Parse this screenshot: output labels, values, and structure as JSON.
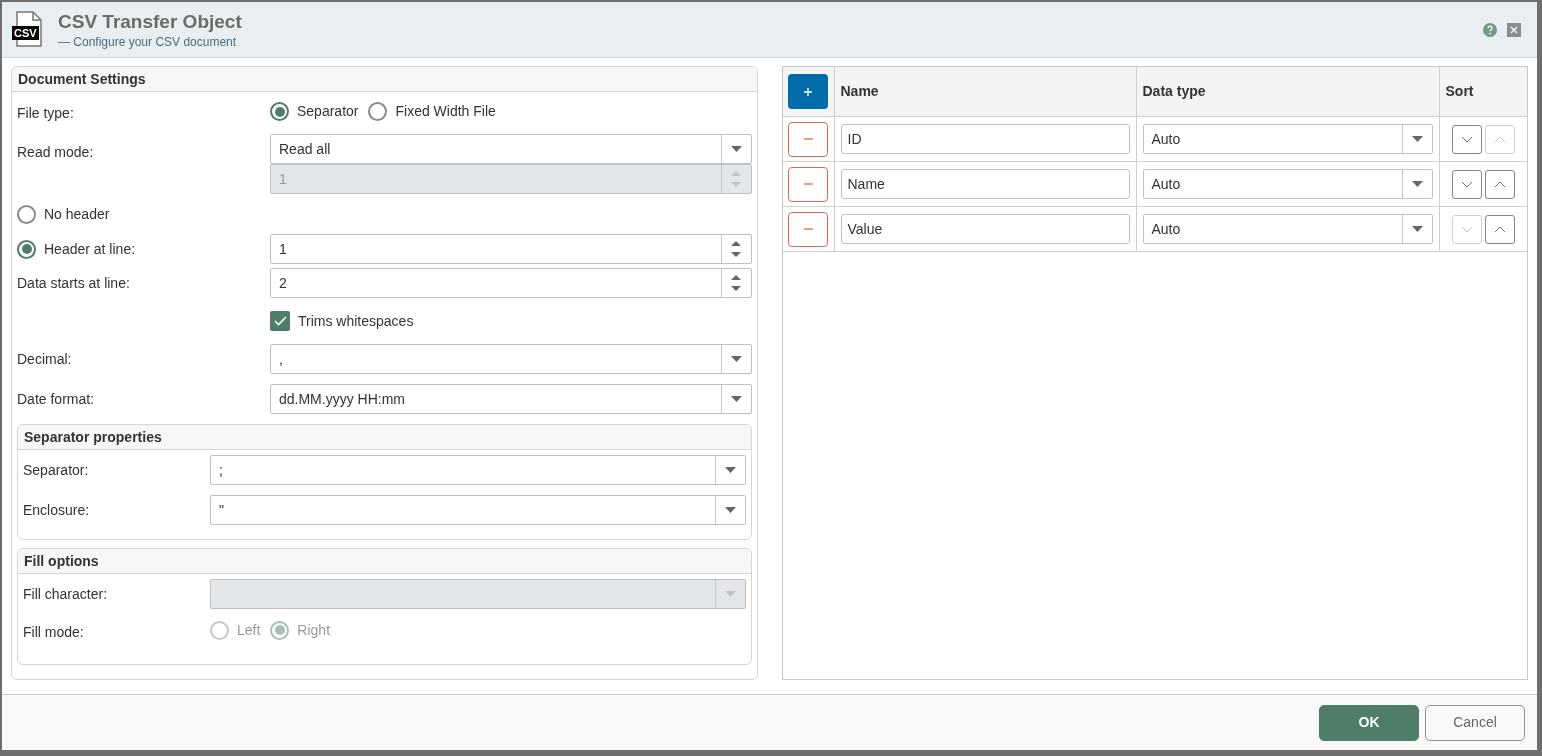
{
  "window": {
    "logo_text": "CSV",
    "title": "CSV Transfer Object",
    "subtitle": "— Configure your CSV document"
  },
  "document_settings": {
    "title": "Document Settings",
    "file_type": {
      "label": "File type:",
      "options": [
        {
          "label": "Separator",
          "selected": true
        },
        {
          "label": "Fixed Width File",
          "selected": false
        }
      ]
    },
    "read_mode": {
      "label": "Read mode:",
      "value": "Read all",
      "line_count": {
        "value": "1",
        "disabled": true
      }
    },
    "header_options": [
      {
        "label": "No header",
        "selected": false
      },
      {
        "label": "Header at line:",
        "selected": true,
        "value": "1"
      }
    ],
    "data_start": {
      "label": "Data starts at line:",
      "value": "2"
    },
    "trim": {
      "label": "Trims whitespaces",
      "checked": true
    },
    "decimal": {
      "label": "Decimal:",
      "value": ","
    },
    "date_format": {
      "label": "Date format:",
      "value": "dd.MM.yyyy HH:mm"
    }
  },
  "separator_properties": {
    "title": "Separator properties",
    "fields": [
      {
        "label": "Separator:",
        "value": ";"
      },
      {
        "label": "Enclosure:",
        "value": "\""
      }
    ]
  },
  "fill_options": {
    "title": "Fill options",
    "fill_character": {
      "label": "Fill character:",
      "disabled": true
    },
    "fill_mode": {
      "label": "Fill mode:",
      "disabled": true,
      "options": [
        {
          "label": "Left",
          "selected": false
        },
        {
          "label": "Right",
          "selected": true
        }
      ]
    }
  },
  "columns_table": {
    "columns": [
      "Name",
      "Data type",
      "Sort"
    ],
    "rows": [
      {
        "name": "ID",
        "data_type": "Auto",
        "down_disabled": false,
        "up_disabled": true
      },
      {
        "name": "Name",
        "data_type": "Auto",
        "down_disabled": false,
        "up_disabled": false
      },
      {
        "name": "Value",
        "data_type": "Auto",
        "down_disabled": true,
        "up_disabled": false
      }
    ]
  },
  "buttons": [
    {
      "label": "OK",
      "kind": "primary"
    },
    {
      "label": "Cancel",
      "kind": "secondary"
    }
  ]
}
